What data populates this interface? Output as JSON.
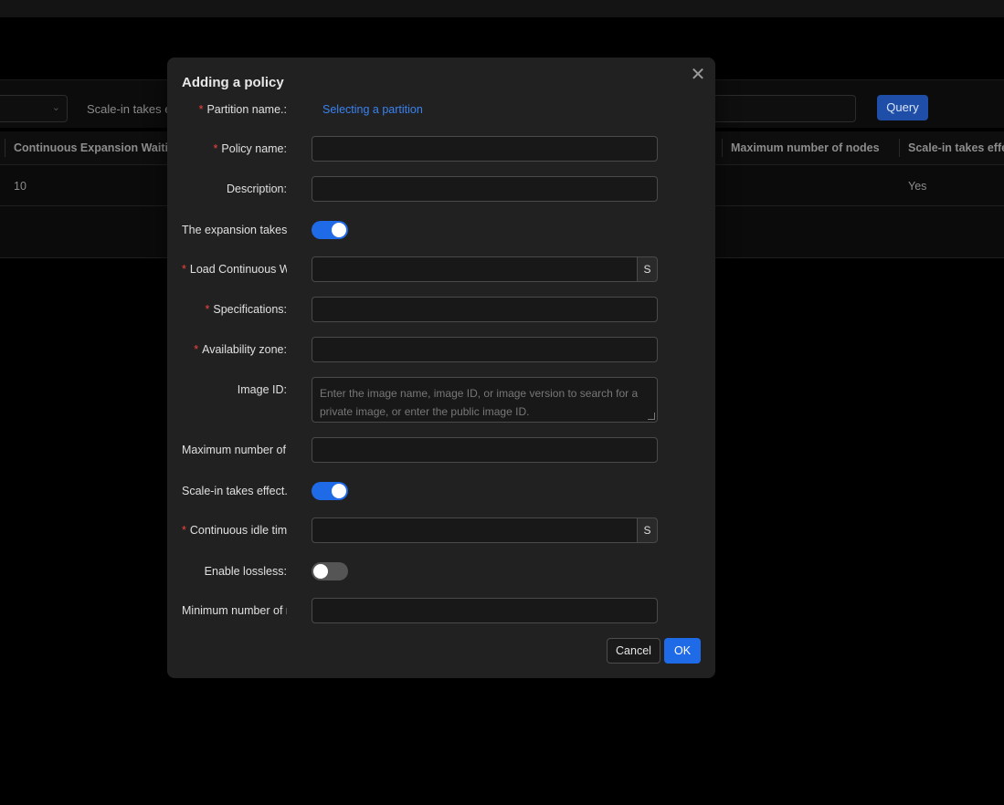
{
  "background": {
    "filter_label": "Scale-in takes eff",
    "query_button": "Query",
    "table": {
      "headers": [
        "Continuous Expansion Waiting",
        "Maximum number of nodes",
        "Scale-in takes effect"
      ],
      "row": {
        "continuous_expansion_waiting": "10",
        "scale_in_takes_effect": "Yes"
      }
    }
  },
  "modal": {
    "title": "Adding a policy",
    "close_icon": "close-icon",
    "fields": {
      "partition_name": {
        "label": "Partition name.",
        "required": true,
        "link_text": "Selecting a partition"
      },
      "policy_name": {
        "label": "Policy name",
        "required": true,
        "value": ""
      },
      "description": {
        "label": "Description",
        "value": ""
      },
      "expansion_takes_effect": {
        "label": "The expansion takes ef",
        "enabled": true
      },
      "load_continuous_wait": {
        "label": "Load Continuous Wa",
        "required": true,
        "value": "",
        "suffix": "S"
      },
      "specifications": {
        "label": "Specifications",
        "required": true,
        "value": ""
      },
      "availability_zone": {
        "label": "Availability zone",
        "required": true,
        "value": ""
      },
      "image_id": {
        "label": "Image ID",
        "placeholder": "Enter the image name, image ID, or image version to search for a private image, or enter the public image ID."
      },
      "maximum_nodes": {
        "label": "Maximum number of n",
        "value": ""
      },
      "scale_in_takes_effect": {
        "label": "Scale-in takes effect.",
        "enabled": true
      },
      "continuous_idle_time": {
        "label": "Continuous idle time",
        "required": true,
        "value": "",
        "suffix": "S"
      },
      "enable_lossless": {
        "label": "Enable lossless",
        "enabled": false
      },
      "minimum_nodes": {
        "label": "Minimum number of n",
        "value": ""
      }
    },
    "buttons": {
      "cancel": "Cancel",
      "ok": "OK"
    },
    "colors": {
      "primary": "#1f6ae6",
      "required": "#f0443c",
      "link": "#3b82f0"
    }
  }
}
